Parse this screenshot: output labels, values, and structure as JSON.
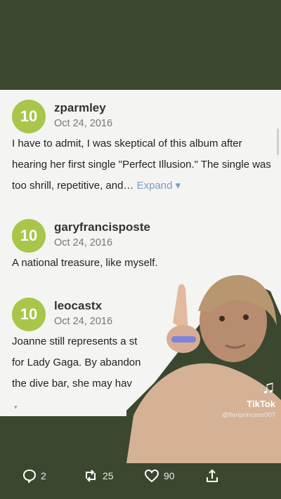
{
  "reviews": [
    {
      "score": "10",
      "user": "zparmley",
      "date": "Oct 24, 2016",
      "text": "I have to admit, I was skeptical of this album after hearing her first single \"Perfect Illusion.\" The single was too shrill, repetitive, and… ",
      "expand": "Expand ▾"
    },
    {
      "score": "10",
      "user": "garyfrancisposte",
      "date": "Oct 24, 2016",
      "text": "A national treasure, like myself."
    },
    {
      "score": "10",
      "user": "leocastx",
      "date": "Oct 24, 2016",
      "text": "Joanne still represents a st for Lady Gaga. By abandon the dive bar, she may hav"
    }
  ],
  "overlay": {
    "brand": "TikTok",
    "handle": "@fieriprincess007"
  },
  "actions": {
    "comments": "2",
    "reposts": "25",
    "likes": "90"
  },
  "colors": {
    "score_badge": "#a7c64a",
    "expand_link": "#7a9cc7",
    "background": "#3b472f"
  }
}
